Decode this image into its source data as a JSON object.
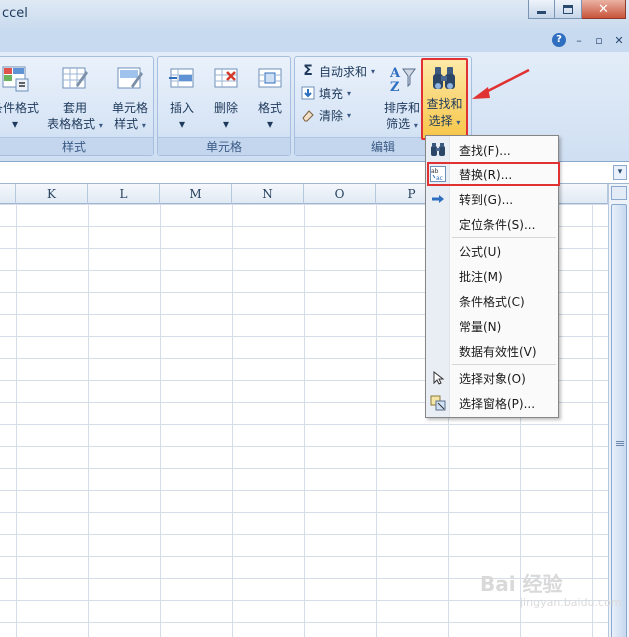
{
  "window": {
    "title": "ccel"
  },
  "ribbon": {
    "styles_group": {
      "label": "样式",
      "buttons": [
        {
          "line1": "条件格式",
          "line2": ""
        },
        {
          "line1": "套用",
          "line2": "表格格式"
        },
        {
          "line1": "单元格",
          "line2": "样式"
        }
      ]
    },
    "cells_group": {
      "label": "单元格",
      "buttons": [
        {
          "label": "插入"
        },
        {
          "label": "删除"
        },
        {
          "label": "格式"
        }
      ]
    },
    "editing_group": {
      "label": "编辑",
      "small_buttons": [
        {
          "label": "自动求和"
        },
        {
          "label": "填充"
        },
        {
          "label": "清除"
        }
      ],
      "sort_button": {
        "line1": "排序和",
        "line2": "筛选"
      },
      "find_button": {
        "line1": "查找和",
        "line2": "选择"
      }
    }
  },
  "columns": [
    "K",
    "L",
    "M",
    "N",
    "O",
    "P"
  ],
  "menu": {
    "items": [
      {
        "label": "查找(F)...",
        "icon": "binoculars-icon"
      },
      {
        "label": "替换(R)...",
        "icon": "replace-icon"
      },
      {
        "label": "转到(G)...",
        "icon": "arrow-right-icon"
      },
      {
        "label": "定位条件(S)...",
        "icon": ""
      },
      {
        "label": "公式(U)",
        "icon": ""
      },
      {
        "label": "批注(M)",
        "icon": ""
      },
      {
        "label": "条件格式(C)",
        "icon": ""
      },
      {
        "label": "常量(N)",
        "icon": ""
      },
      {
        "label": "数据有效性(V)",
        "icon": ""
      },
      {
        "label": "选择对象(O)",
        "icon": "cursor-icon"
      },
      {
        "label": "选择窗格(P)...",
        "icon": "selection-pane-icon"
      }
    ]
  },
  "colors": {
    "highlight": "#e03232",
    "ribbon": "#d6e4f5"
  },
  "watermark": {
    "text": "Bai 经验",
    "sub": "jingyan.baidu.com"
  }
}
